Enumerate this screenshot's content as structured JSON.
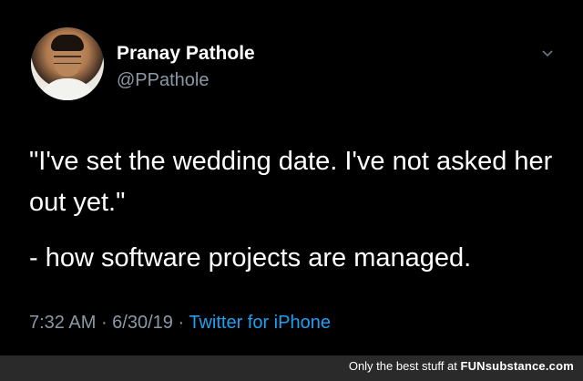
{
  "tweet": {
    "author_name": "Pranay Pathole",
    "author_handle": "@PPathole",
    "text_line_1": "\"I've set the wedding date. I've not asked her out yet.\"",
    "text_line_2": "- how software projects are managed.",
    "time": "7:32 AM",
    "separator_1": " · ",
    "date": "6/30/19",
    "separator_2": " · ",
    "source": "Twitter for iPhone",
    "menu_icon": "chevron-down-icon",
    "avatar_icon": "avatar"
  },
  "footer": {
    "watermark_prefix": "Only the best stuff at ",
    "watermark_brand": "FUNsubstance.com"
  },
  "colors": {
    "background": "#000000",
    "text_primary": "#ffffff",
    "text_secondary": "#8b98a5",
    "link_blue": "#1da1f2",
    "footer_bg": "#2a2a2a"
  }
}
